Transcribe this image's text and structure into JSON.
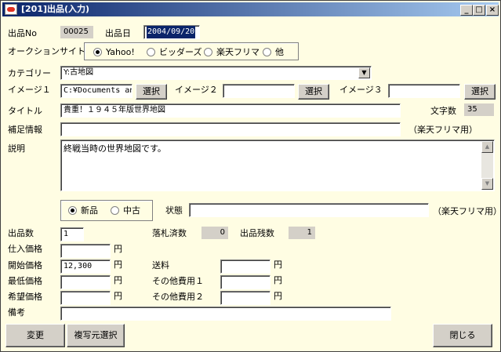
{
  "window": {
    "title": "[201]出品(入力)"
  },
  "controls": {
    "minimize": "_",
    "maximize": "□",
    "close": "×"
  },
  "item_no": {
    "label": "出品No",
    "value": "00025"
  },
  "listing_date": {
    "label": "出品日",
    "value": "2004/09/20"
  },
  "auction_site": {
    "label": "オークションサイト",
    "options": [
      {
        "label": "Yahoo!",
        "selected": true
      },
      {
        "label": "ビッダーズ",
        "selected": false
      },
      {
        "label": "楽天フリマ",
        "selected": false
      },
      {
        "label": "他",
        "selected": false
      }
    ]
  },
  "category": {
    "label": "カテゴリー",
    "value": "Y:古地図"
  },
  "images": {
    "image1": {
      "label": "イメージ１",
      "value": "C:¥Documents an"
    },
    "image2": {
      "label": "イメージ２",
      "value": ""
    },
    "image3": {
      "label": "イメージ３",
      "value": ""
    },
    "select_label": "選択"
  },
  "title": {
    "label": "タイトル",
    "value": "貴重！１９４５年版世界地図"
  },
  "char_count": {
    "label": "文字数",
    "value": "35"
  },
  "supplement": {
    "label": "補足情報",
    "value": "",
    "note": "（楽天フリマ用）"
  },
  "description": {
    "label": "説明",
    "value": "終戦当時の世界地図です。"
  },
  "condition": {
    "options": [
      {
        "label": "新品",
        "selected": true
      },
      {
        "label": "中古",
        "selected": false
      }
    ],
    "state_label": "状態",
    "state_value": "",
    "note": "（楽天フリマ用）"
  },
  "quantity": {
    "label": "出品数",
    "value": "1"
  },
  "sold_count": {
    "label": "落札済数",
    "value": "0"
  },
  "remaining": {
    "label": "出品残数",
    "value": "1"
  },
  "yen": "円",
  "purchase_price": {
    "label": "仕入価格",
    "value": ""
  },
  "start_price": {
    "label": "開始価格",
    "value": "12,300"
  },
  "min_price": {
    "label": "最低価格",
    "value": ""
  },
  "desired_price": {
    "label": "希望価格",
    "value": ""
  },
  "shipping": {
    "label": "送料",
    "value": ""
  },
  "other1": {
    "label": "その他費用１",
    "value": ""
  },
  "other2": {
    "label": "その他費用２",
    "value": ""
  },
  "remarks": {
    "label": "備考",
    "value": ""
  },
  "buttons": {
    "change": "変更",
    "copy_source": "複写元選択",
    "close": "閉じる"
  }
}
